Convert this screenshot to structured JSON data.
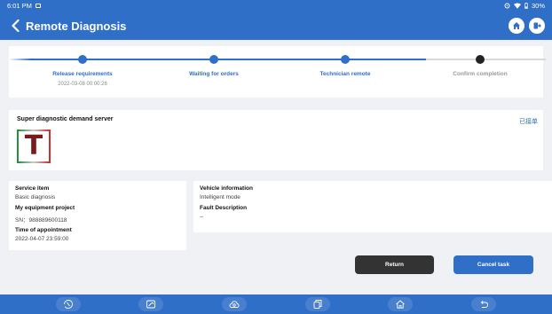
{
  "status_bar": {
    "time": "6:01 PM",
    "battery": "30%"
  },
  "header": {
    "title": "Remote Diagnosis"
  },
  "progress": {
    "steps": [
      {
        "label": "Release requirements",
        "date": "2022-03-08 00:00:26"
      },
      {
        "label": "Waiting for orders",
        "date": ""
      },
      {
        "label": "Technician remote",
        "date": ""
      },
      {
        "label": "Confirm completion",
        "date": ""
      }
    ]
  },
  "server": {
    "title": "Super diagnostic demand server",
    "status": "已接单",
    "logo_letter": "T"
  },
  "service": {
    "service_item_label": "Service item",
    "service_item_value": "Basic diagnosis",
    "equipment_label": "My equipment project",
    "equipment_value": "SN：988889600118",
    "appointment_label": "Time of appointment",
    "appointment_value": "2022-04-07 23:59:00"
  },
  "vehicle": {
    "info_label": "Vehicle information",
    "info_value": "Intelligent mode",
    "fault_label": "Fault Description",
    "fault_value": "--"
  },
  "actions": {
    "return_label": "Return",
    "cancel_label": "Cancel task"
  },
  "colors": {
    "primary": "#2f6fc8",
    "dark_button": "#333333",
    "background": "#f0f1f4"
  },
  "icons": {
    "status_bar": [
      "notification-icon",
      "location-icon",
      "wifi-icon",
      "battery-icon"
    ],
    "header": [
      "back-icon",
      "home-icon",
      "exit-icon"
    ],
    "nav": [
      "diagnosis-icon",
      "repair-icon",
      "cloud-icon",
      "copy-icon",
      "home-icon",
      "back-icon"
    ]
  }
}
